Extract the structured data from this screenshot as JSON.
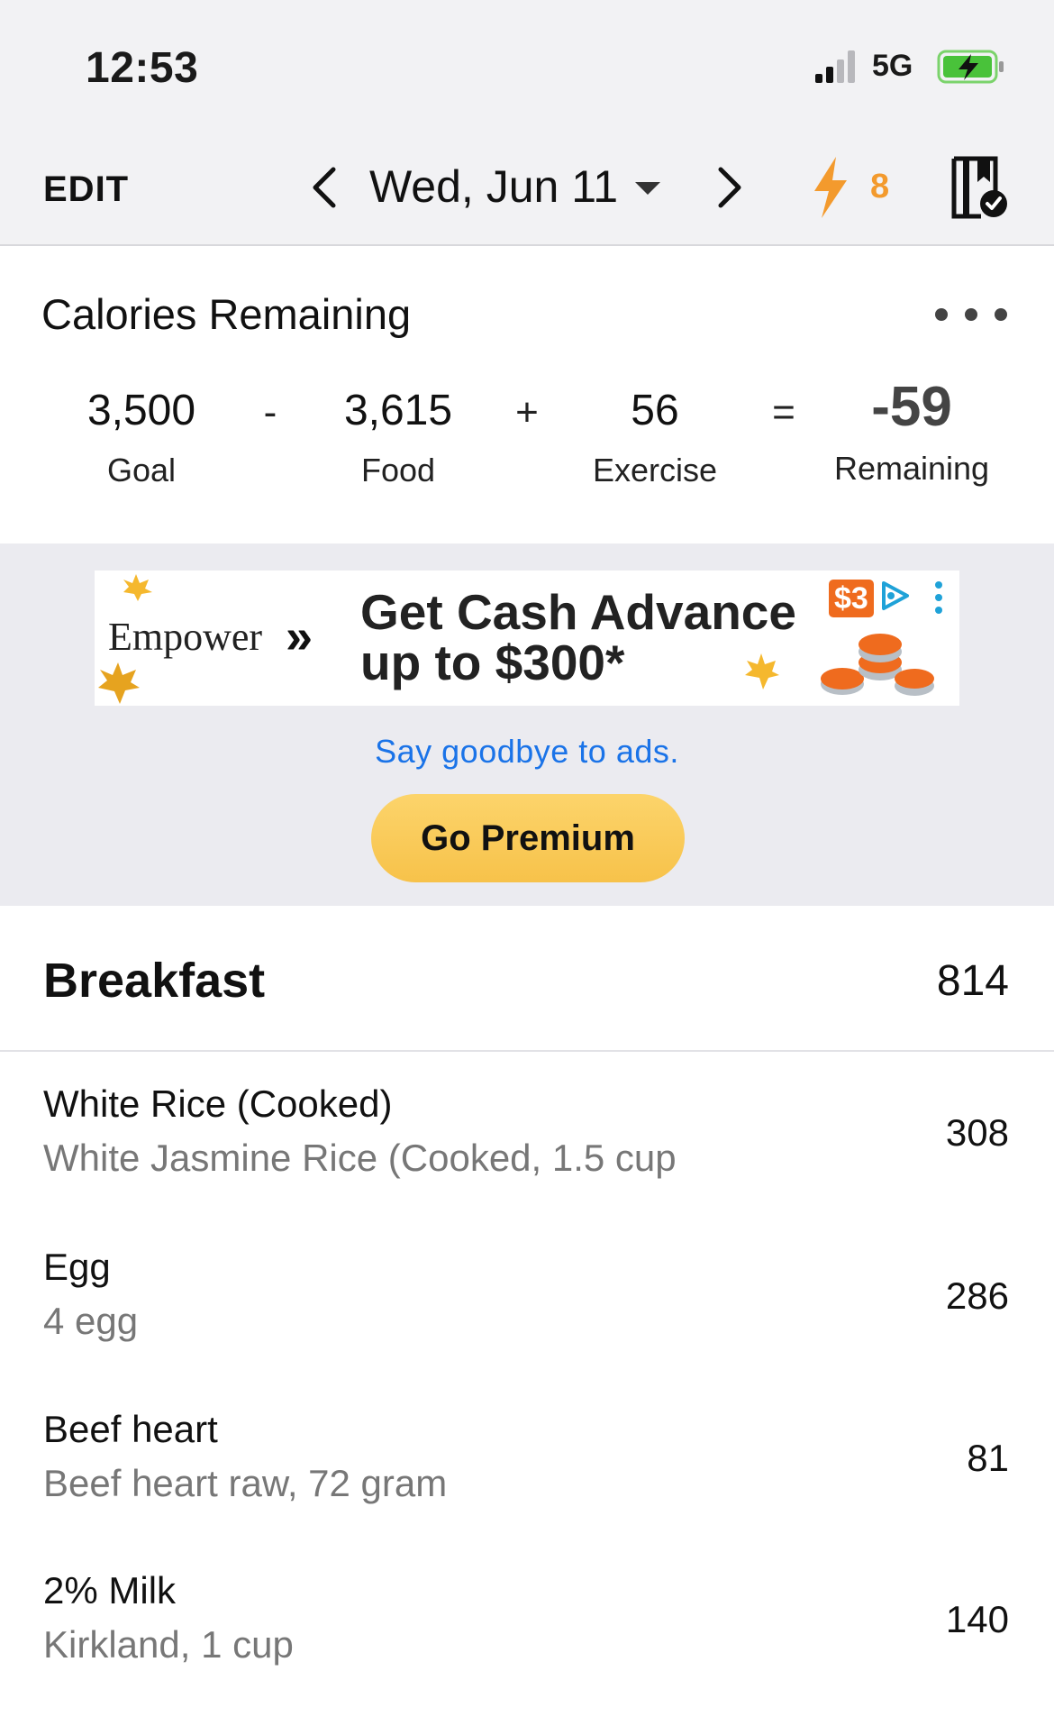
{
  "status_bar": {
    "time": "12:53",
    "network": "5G",
    "battery_icon": "battery-charging-icon"
  },
  "nav": {
    "edit_label": "EDIT",
    "date": "Wed, Jun 11",
    "streak_count": "8",
    "accent_color": "#f39a2d"
  },
  "calories": {
    "title": "Calories Remaining",
    "goal": {
      "value": "3,500",
      "label": "Goal"
    },
    "food": {
      "value": "3,615",
      "label": "Food"
    },
    "exercise": {
      "value": "56",
      "label": "Exercise"
    },
    "remaining": {
      "value": "-59",
      "label": "Remaining"
    },
    "ops": {
      "minus": "-",
      "plus": "+",
      "equals": "="
    }
  },
  "ad": {
    "brand": "Empower",
    "brand_arrows": "»",
    "headline_line1": "Get Cash Advance",
    "headline_line2": "up to $300*",
    "badge": "$3",
    "say_goodbye": "Say goodbye to ads.",
    "premium_label": "Go Premium"
  },
  "meal": {
    "name": "Breakfast",
    "total": "814",
    "items": [
      {
        "name": "White Rice (Cooked)",
        "desc": "White Jasmine  Rice (Cooked, 1.5 cup",
        "cal": "308"
      },
      {
        "name": "Egg",
        "desc": "4 egg",
        "cal": "286"
      },
      {
        "name": "Beef heart",
        "desc": "Beef  heart raw, 72 gram",
        "cal": "81"
      },
      {
        "name": "2% Milk",
        "desc": "Kirkland, 1 cup",
        "cal": "140"
      }
    ]
  }
}
